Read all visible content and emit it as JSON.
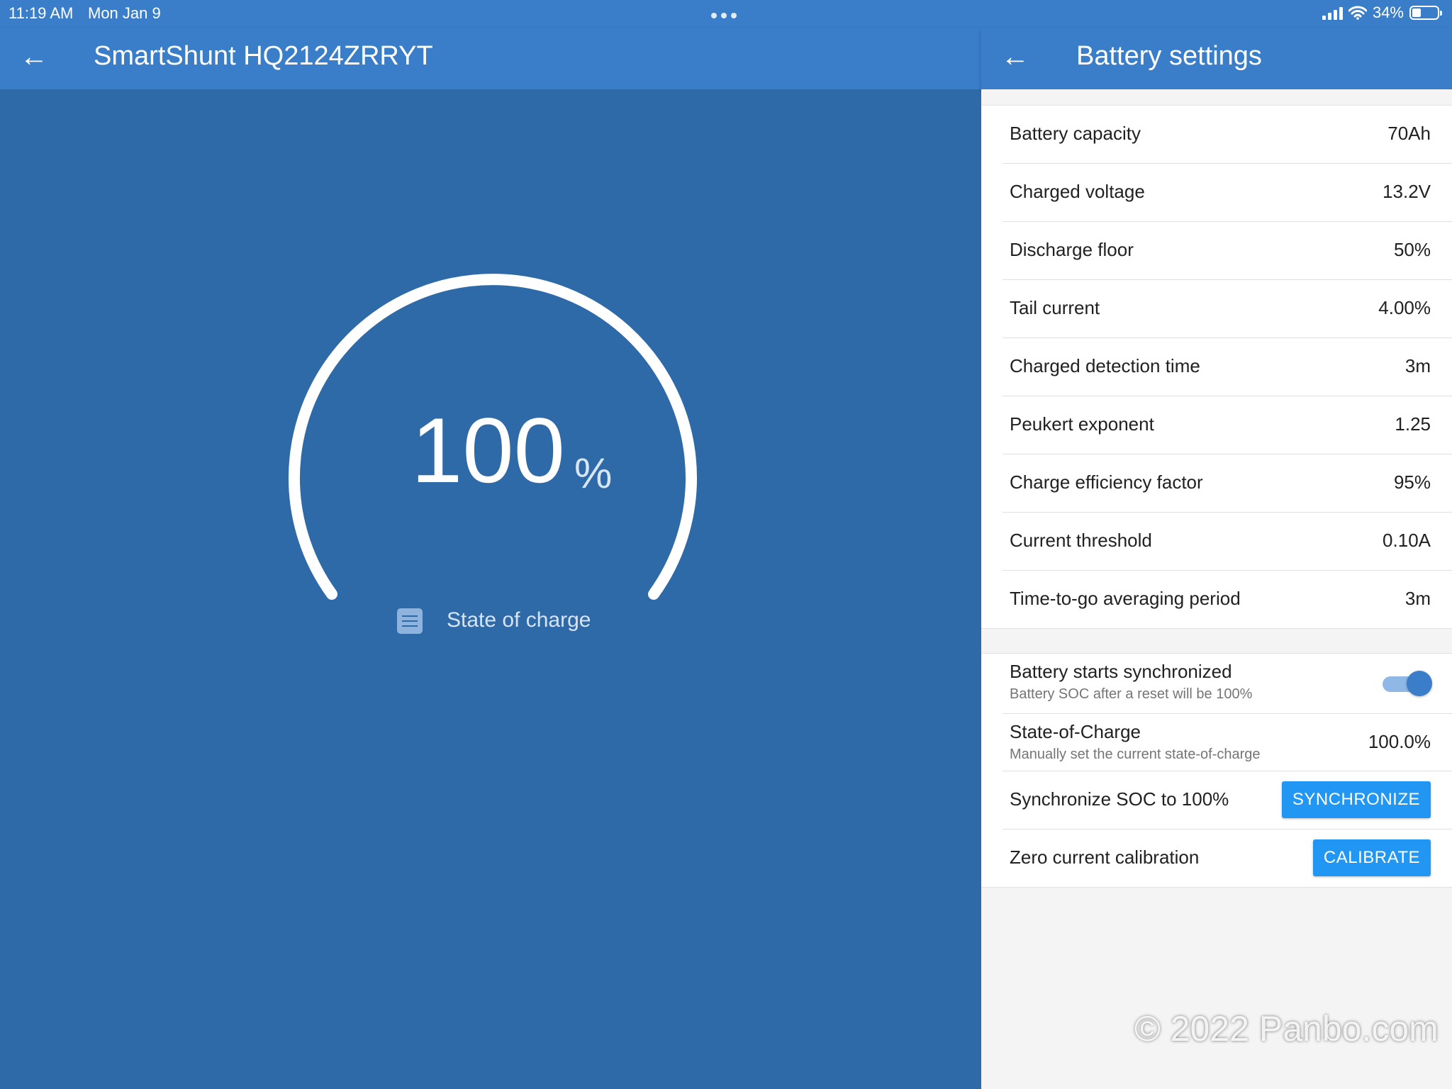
{
  "status_bar": {
    "time": "11:19 AM",
    "date": "Mon Jan 9",
    "battery_percent": "34%",
    "battery_level": 0.34
  },
  "left": {
    "title": "SmartShunt HQ2124ZRRYT",
    "soc_value": "100",
    "soc_unit": "%",
    "soc_label": "State of charge",
    "gauge_fill": 1.0
  },
  "right": {
    "title": "Battery settings",
    "settings": [
      {
        "label": "Battery capacity",
        "value": "70Ah"
      },
      {
        "label": "Charged voltage",
        "value": "13.2V"
      },
      {
        "label": "Discharge floor",
        "value": "50%"
      },
      {
        "label": "Tail current",
        "value": "4.00%"
      },
      {
        "label": "Charged detection time",
        "value": "3m"
      },
      {
        "label": "Peukert exponent",
        "value": "1.25"
      },
      {
        "label": "Charge efficiency factor",
        "value": "95%"
      },
      {
        "label": "Current threshold",
        "value": "0.10A"
      },
      {
        "label": "Time-to-go averaging period",
        "value": "3m"
      }
    ],
    "sync": {
      "starts_label": "Battery starts synchronized",
      "starts_sub": "Battery SOC after a reset will be 100%",
      "starts_on": true,
      "soc_label": "State-of-Charge",
      "soc_sub": "Manually set the current state-of-charge",
      "soc_value": "100.0%",
      "sync_label": "Synchronize SOC to 100%",
      "sync_button": "SYNCHRONIZE",
      "calib_label": "Zero current calibration",
      "calib_button": "CALIBRATE"
    }
  },
  "watermark": "© 2022 Panbo.com",
  "colors": {
    "appbar": "#3a7dc9",
    "background": "#2e69a8",
    "button": "#2196f3"
  }
}
